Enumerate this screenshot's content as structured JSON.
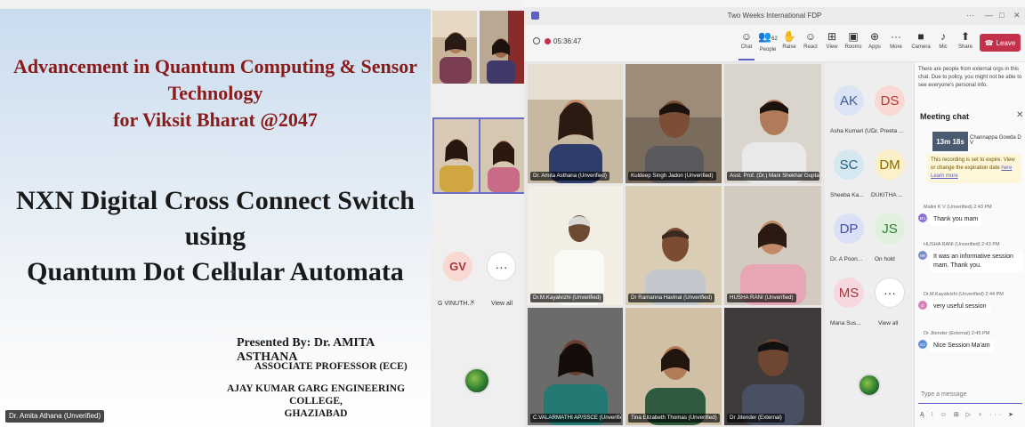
{
  "slide": {
    "title_line1": "Advancement in Quantum Computing & Sensor Technology",
    "title_line2": "for Viksit Bharat @2047",
    "topic_line1": "NXN Digital Cross Connect Switch using",
    "topic_line2": "Quantum Dot Cellular Automata",
    "presented_by": "Presented By:  Dr. AMITA ASTHANA",
    "designation": "ASSOCIATE PROFESSOR (ECE)",
    "college_line1": "AJAY KUMAR GARG ENGINEERING COLLEGE,",
    "college_line2": "GHAZIABAD",
    "speaker_tag": "Dr. Amita Athana (Unverified)"
  },
  "strip": {
    "avatar": {
      "initials": "GV",
      "label": "G VINUTH...",
      "bg": "#f8d8d0",
      "fg": "#a4373a"
    },
    "view_all": "View all",
    "more_glyph": "···"
  },
  "window": {
    "title": "Two Weeks International FDP",
    "controls": [
      "—",
      "□",
      "✕"
    ],
    "more_glyph": "···"
  },
  "toolbar": {
    "timer": "05:36:47",
    "items": [
      {
        "icon": "chat-icon",
        "glyph": "☺",
        "label": "Chat"
      },
      {
        "icon": "people-icon",
        "glyph": "👥",
        "label": "People",
        "count": "62"
      },
      {
        "icon": "raise-hand-icon",
        "glyph": "✋",
        "label": "Raise"
      },
      {
        "icon": "react-icon",
        "glyph": "☺",
        "label": "React"
      },
      {
        "icon": "view-icon",
        "glyph": "⊞",
        "label": "View"
      },
      {
        "icon": "rooms-icon",
        "glyph": "▣",
        "label": "Rooms"
      },
      {
        "icon": "apps-icon",
        "glyph": "⊕",
        "label": "Apps"
      },
      {
        "icon": "more-icon",
        "glyph": "···",
        "label": "More"
      },
      {
        "icon": "camera-icon",
        "glyph": "■",
        "label": "Camera"
      },
      {
        "icon": "mic-icon",
        "glyph": "♪",
        "label": "Mic"
      },
      {
        "icon": "share-icon",
        "glyph": "⬆",
        "label": "Share"
      }
    ],
    "leave_label": "Leave",
    "leave_color": "#c4314b"
  },
  "tiles": [
    {
      "name": "Dr. Amita Asthana (Unverified)"
    },
    {
      "name": "Kuldeep Singh Jadon (Unverified)"
    },
    {
      "name": "Asst. Prof. (Dr.) Mani Shekhar Gupta..."
    },
    {
      "name": "Dr.M.Kayalvizhi (Unverified)"
    },
    {
      "name": "Dr Ramanna Havinal (Unverified)"
    },
    {
      "name": "HUSHA RANI (Unverified)"
    },
    {
      "name": "C.VALARMATHI AP/SSCE (Unverified)"
    },
    {
      "name": "Tina Elizabeth Thomas (Unverified)"
    },
    {
      "name": "Dr Jitender (External)"
    }
  ],
  "roster": [
    {
      "initials": "AK",
      "label": "Asha Kumari (U...",
      "bg": "#dbe4f5",
      "fg": "#3d5a99"
    },
    {
      "initials": "DS",
      "label": "Dr. Preeta ...",
      "bg": "#f9d9d3",
      "fg": "#b03a2e"
    },
    {
      "initials": "SC",
      "label": "Sheeba Ka...",
      "bg": "#d5e8f2",
      "fg": "#1e5f80"
    },
    {
      "initials": "DM",
      "label": "DUKITHA ...",
      "bg": "#fbf0c7",
      "fg": "#8a6b00"
    },
    {
      "initials": "DP",
      "label": "Dr. A Poon...",
      "bg": "#dbe0f7",
      "fg": "#3f4fa3"
    },
    {
      "initials": "JS",
      "label": "On hold",
      "bg": "#dff0dc",
      "fg": "#2f7a35"
    },
    {
      "initials": "MS",
      "label": "Mana Sus...",
      "bg": "#f7d8de",
      "fg": "#a4373a"
    }
  ],
  "roster_view_all": "View all",
  "chat": {
    "notice": "There are people from external orgs in this chat. Due to policy, you might not be able to see everyone's personal info.",
    "header": "Meeting chat",
    "rec_duration": "13m 18s",
    "rec_name": "Channappa Gowda D V",
    "rec_note_text": "This recording is set to expire. View or change the expiration date",
    "rec_note_link1": "here",
    "rec_note_link2": "Learn more",
    "messages": [
      {
        "meta": "Malini K V (Unverified)  2:43 PM",
        "text": "Thank you mam",
        "initials": "MV",
        "color": "#8b6fd6"
      },
      {
        "meta": "HUSHA RANI (Unverified)  2:43 PM",
        "text": "It was an informative session mam. Thank you.",
        "initials": "HR",
        "color": "#7a8ec9"
      },
      {
        "meta": "Dr.M.Kayalvizhi (Unverified)  2:44 PM",
        "text": "very useful session",
        "initials": "D",
        "color": "#d67fb8"
      },
      {
        "meta": "Dr Jitender (External)  2:45 PM",
        "text": "Nice Session Ma'am",
        "initials": "DJ",
        "color": "#5b8fd6"
      }
    ],
    "compose_placeholder": "Type a message",
    "compose_tools": "Ą ⁝ ☺ ⊞ ▷ ♀ ··· ➤"
  },
  "colors": {
    "accent": "#5b5fc7",
    "slide_title": "#8b1a1a"
  }
}
